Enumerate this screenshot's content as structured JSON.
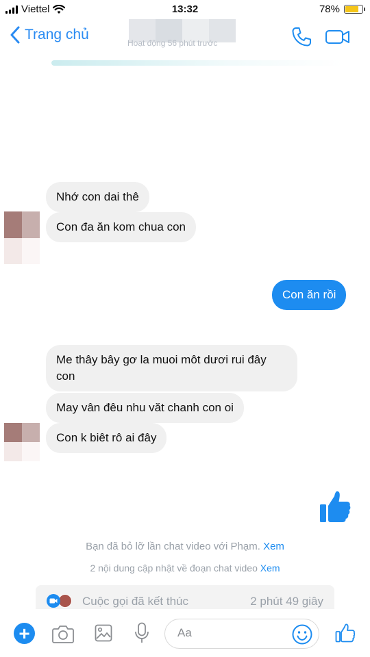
{
  "status_bar": {
    "carrier": "Viettel",
    "time": "13:32",
    "battery_percent": "78%",
    "battery_level": 0.78
  },
  "header": {
    "back_label": "Trang chủ",
    "last_active": "Hoạt động 56 phút trước"
  },
  "messages": [
    {
      "text": "Nhớ con dai thê",
      "direction": "incoming"
    },
    {
      "text": "Con đa ăn kom chua con",
      "direction": "incoming"
    },
    {
      "text": "Con ăn rồi",
      "direction": "outgoing"
    },
    {
      "text_line1": "Me thây bây gơ la muoi môt dươi rui đây",
      "text_line2": "con",
      "direction": "incoming"
    },
    {
      "text": "May vân đêu nhu văt chanh con oi",
      "direction": "incoming"
    },
    {
      "text": "Con k biêt rô ai đây",
      "direction": "incoming"
    }
  ],
  "notes": {
    "missed_video": "Bạn đã bỏ lỡ lần chat video với Phạm.",
    "missed_link": "Xem",
    "updates": "2 nội dung cập nhật về đoạn chat video",
    "updates_link": "Xem"
  },
  "call_card": {
    "label": "Cuộc gọi đã kết thúc",
    "duration": "2 phút 49 giây"
  },
  "composer": {
    "placeholder": "Aa"
  },
  "colors": {
    "accent": "#1d8cf0",
    "incoming_bubble": "#f0f0f0",
    "battery": "#f5c518"
  },
  "icons": [
    "signal-icon",
    "wifi-icon",
    "battery-icon",
    "back-chevron-icon",
    "phone-icon",
    "video-camera-icon",
    "thumbs-up-icon",
    "plus-icon",
    "camera-icon",
    "image-icon",
    "microphone-icon",
    "emoji-icon"
  ]
}
